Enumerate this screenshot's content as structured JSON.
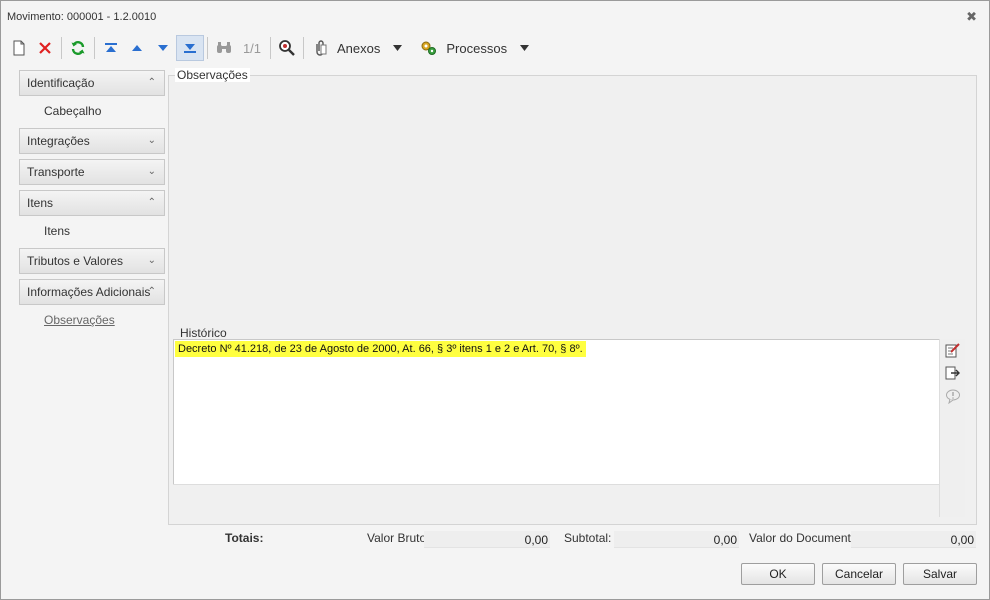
{
  "window": {
    "title": "Movimento: 000001 - 1.2.0010"
  },
  "toolbar": {
    "record_indicator": "1/1",
    "anexos_label": "Anexos",
    "processos_label": "Processos"
  },
  "sidebar": {
    "groups": [
      {
        "label": "Identificação",
        "expanded": true,
        "items": [
          "Cabeçalho"
        ]
      },
      {
        "label": "Integrações",
        "expanded": false
      },
      {
        "label": "Transporte",
        "expanded": false
      },
      {
        "label": "Itens",
        "expanded": true,
        "items": [
          "Itens"
        ]
      },
      {
        "label": "Tributos e Valores",
        "expanded": false
      },
      {
        "label": "Informações Adicionais",
        "expanded": true,
        "items": [
          "Observações"
        ]
      }
    ]
  },
  "observacoes": {
    "section_label": "Observações",
    "historico_label": "Histórico",
    "historico_text": "Decreto Nº 41.218, de 23 de Agosto de 2000, At. 66, § 3º itens 1 e 2 e Art. 70, § 8º."
  },
  "totals": {
    "label": "Totais:",
    "valor_bruto_label": "Valor Bruto:",
    "valor_bruto_value": "0,00",
    "subtotal_label": "Subtotal: :",
    "subtotal_value": "0,00",
    "valor_documento_label": "Valor do Documento:",
    "valor_documento_value": "0,00"
  },
  "buttons": {
    "ok": "OK",
    "cancel": "Cancelar",
    "save": "Salvar"
  },
  "colors": {
    "highlight": "#ffff40",
    "delete_red": "#e02020",
    "refresh_green": "#1a9a2a",
    "nav_blue": "#2a6fd0"
  }
}
